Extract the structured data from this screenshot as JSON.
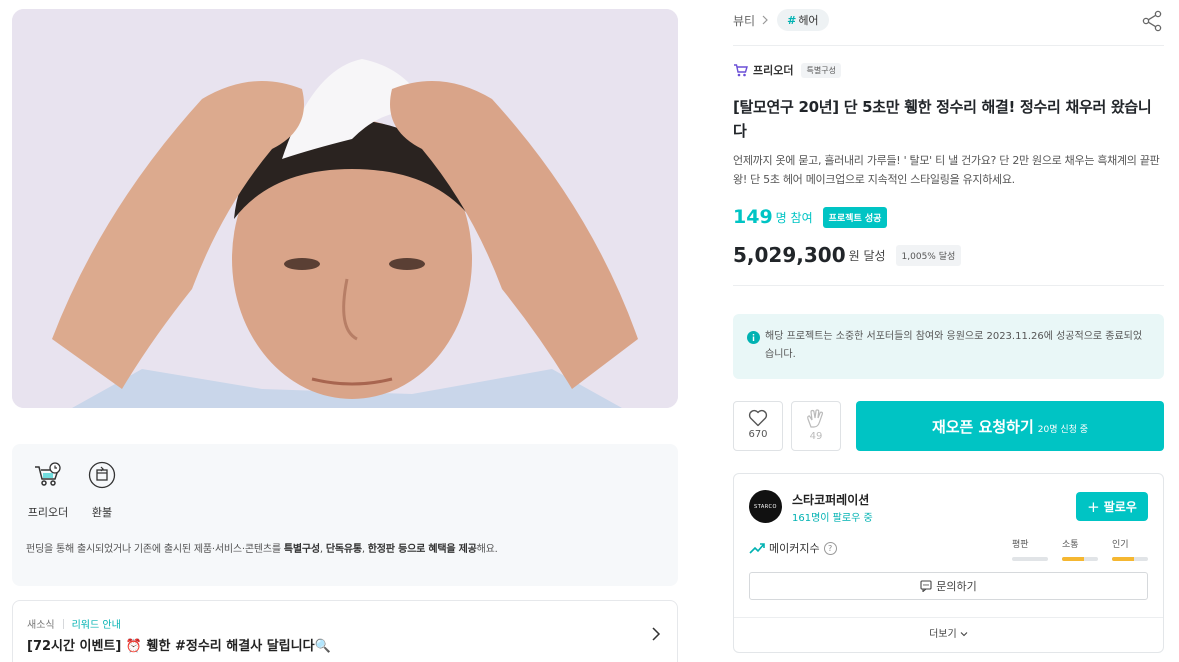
{
  "breadcrumb": {
    "category": "뷰티",
    "tag": "헤어",
    "tag_hash": "#"
  },
  "brand": {
    "name": "프리오더",
    "badge": "특별구성"
  },
  "project": {
    "title": "[탈모연구 20년] 단 5초만 휑한 정수리 해결! 정수리 채우러 왔습니다",
    "description": "언제까지 옷에 묻고, 흘러내리 가루들! ' 탈모' 티 낼 건가요? 단 2만 원으로 채우는 흑채계의 끝판왕! 단 5초 헤어 메이크업으로 지속적인 스타일링을 유지하세요.",
    "participants": "149",
    "participants_unit": "명 참여",
    "success_badge": "프로젝트 성공",
    "amount": "5,029,300",
    "amount_unit": "원 달성",
    "achievement": "1,005% 달성"
  },
  "notice": {
    "text": "해당 프로젝트는 소중한 서포터들의 참여와 응원으로 2023.11.26에 성공적으로 종료되었습니다."
  },
  "actions": {
    "like_count": "670",
    "cheer_count": "49",
    "reopen_label": "재오픈 요청하기",
    "reopen_sub": "20명 신청 중"
  },
  "maker": {
    "logo_text": "STARCO",
    "name": "스타코퍼레이션",
    "followers": "161명이 팔로우 중",
    "follow_label": "팔로우",
    "follow_plus": "+",
    "index_label": "메이커지수",
    "metrics": [
      {
        "label": "평판",
        "level": 0.0
      },
      {
        "label": "소통",
        "level": 0.6
      },
      {
        "label": "인기",
        "level": 0.6
      }
    ],
    "inquiry_label": "문의하기",
    "more_label": "더보기"
  },
  "benefits": {
    "items": [
      {
        "label": "프리오더",
        "icon": "cart-clock-icon"
      },
      {
        "label": "환불",
        "icon": "refund-box-icon"
      }
    ],
    "desc_prefix": "펀딩을 통해 출시되었거나 기존에 출시된 제품·서비스·콘텐츠를 ",
    "desc_bold1": "특별구성",
    "desc_mid1": ", ",
    "desc_bold2": "단독유통",
    "desc_mid2": ", ",
    "desc_bold3": "한정판 등으로 혜택을 제공",
    "desc_suffix": "해요."
  },
  "news": {
    "tag": "새소식",
    "guide": "리워드 안내",
    "title": "[72시간 이벤트] ⏰ 휑한 #정수리 해결사 달립니다🔍"
  },
  "colors": {
    "accent": "#00c4c4",
    "accent_text": "#00b2b2",
    "metric_fill": "#f5b731"
  }
}
